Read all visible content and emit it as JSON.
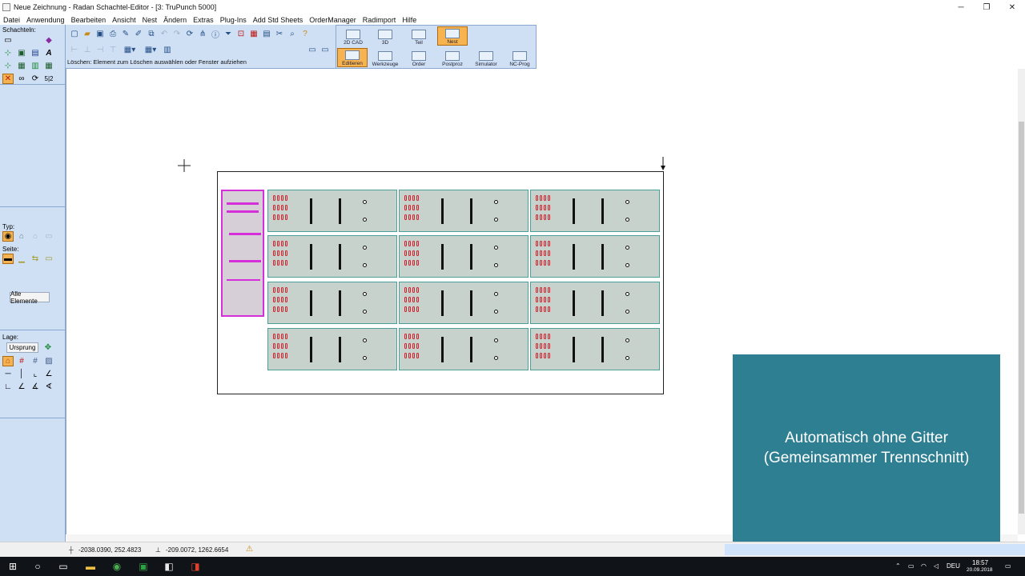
{
  "window": {
    "title": "Neue Zeichnung - Radan Schachtel-Editor - [3: TruPunch 5000]",
    "controls": [
      "─",
      "❐",
      "✕"
    ]
  },
  "menu": [
    "Datei",
    "Anwendung",
    "Bearbeiten",
    "Ansicht",
    "Nest",
    "Ändern",
    "Extras",
    "Plug-Ins",
    "Add Std Sheets",
    "OrderManager",
    "Radimport",
    "Hilfe"
  ],
  "left_panel": {
    "schachteln_label": "Schachteln:",
    "typ_label": "Typ:",
    "seite_label": "Seite:",
    "alle_elemente_button": "Alle Elemente",
    "lage_label": "Lage:",
    "ursprung_button": "Ursprung",
    "fraction_tool": "5|2",
    "text_tool": "A"
  },
  "toolbar": {
    "status_text": "Löschen: Element zum Löschen auswählen oder Fenster aufziehen"
  },
  "mode_buttons": {
    "top": [
      "2D CAD",
      "3D",
      "Teil",
      "Nest"
    ],
    "bottom": [
      "Editieren",
      "Werkzeuge",
      "Order",
      "Postproz",
      "Simulator",
      "NC-Prog"
    ],
    "active_top": "Nest",
    "active_bottom": "Editieren"
  },
  "caption": {
    "line1": "Automatisch ohne Gitter",
    "line2": "(Gemeinsammer Trennschnitt)"
  },
  "statusbar": {
    "coord1": "-2038.0390, 252.4823",
    "coord2": "-209.0072, 1262.6654"
  },
  "taskbar": {
    "language": "DEU",
    "time": "18:57",
    "date": "20.09.2018"
  },
  "colors": {
    "panel": "#cfdff4",
    "active": "#f7b350",
    "caption_bg": "#2f7f93",
    "part_fill": "#c8d2cc",
    "punch_red": "#d1202c",
    "highlight_magenta": "#d42fd9"
  }
}
